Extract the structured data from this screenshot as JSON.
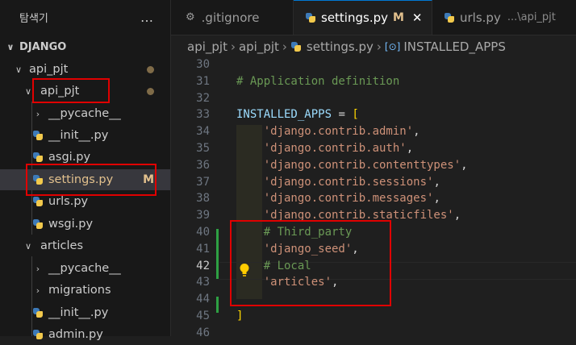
{
  "explorer": {
    "title": "탐색기",
    "more_icon": "…",
    "rows": [
      {
        "label": "DJANGO",
        "chevron": "∨"
      },
      {
        "label": "api_pjt",
        "chevron": "∨"
      },
      {
        "label": "api_pjt",
        "chevron": "∨"
      },
      {
        "label": "__pycache__",
        "chevron": "›"
      },
      {
        "label": "__init__.py"
      },
      {
        "label": "asgi.py"
      },
      {
        "label": "settings.py",
        "badge": "M"
      },
      {
        "label": "urls.py"
      },
      {
        "label": "wsgi.py"
      },
      {
        "label": "articles",
        "chevron": "∨"
      },
      {
        "label": "__pycache__",
        "chevron": "›"
      },
      {
        "label": "migrations",
        "chevron": "›"
      },
      {
        "label": "__init__.py"
      },
      {
        "label": "admin.py"
      }
    ]
  },
  "tabs": [
    {
      "label": ".gitignore",
      "icon": "gear-icon"
    },
    {
      "label": "settings.py",
      "modified": "M",
      "close": "✕",
      "icon": "python-icon"
    },
    {
      "label": "urls.py",
      "desc": "...\\api_pjt",
      "icon": "python-icon"
    }
  ],
  "breadcrumb": {
    "items": [
      "api_pjt",
      "api_pjt",
      "settings.py",
      "INSTALLED_APPS"
    ],
    "symbol": "[⊙]"
  },
  "code": {
    "lines": [
      {
        "n": "30",
        "tokens": []
      },
      {
        "n": "31",
        "tokens": [
          {
            "t": "cmt",
            "v": "# Application definition"
          }
        ]
      },
      {
        "n": "32",
        "tokens": []
      },
      {
        "n": "33",
        "tokens": [
          {
            "t": "id",
            "v": "INSTALLED_APPS"
          },
          {
            "t": "op",
            "v": " = "
          },
          {
            "t": "br",
            "v": "["
          }
        ]
      },
      {
        "n": "34",
        "tokens": [
          {
            "t": "op",
            "v": "    "
          },
          {
            "t": "str",
            "v": "'django.contrib.admin'"
          },
          {
            "t": "op",
            "v": ","
          }
        ]
      },
      {
        "n": "35",
        "tokens": [
          {
            "t": "op",
            "v": "    "
          },
          {
            "t": "str",
            "v": "'django.contrib.auth'"
          },
          {
            "t": "op",
            "v": ","
          }
        ]
      },
      {
        "n": "36",
        "tokens": [
          {
            "t": "op",
            "v": "    "
          },
          {
            "t": "str",
            "v": "'django.contrib.contenttypes'"
          },
          {
            "t": "op",
            "v": ","
          }
        ]
      },
      {
        "n": "37",
        "tokens": [
          {
            "t": "op",
            "v": "    "
          },
          {
            "t": "str",
            "v": "'django.contrib.sessions'"
          },
          {
            "t": "op",
            "v": ","
          }
        ]
      },
      {
        "n": "38",
        "tokens": [
          {
            "t": "op",
            "v": "    "
          },
          {
            "t": "str",
            "v": "'django.contrib.messages'"
          },
          {
            "t": "op",
            "v": ","
          }
        ]
      },
      {
        "n": "39",
        "tokens": [
          {
            "t": "op",
            "v": "    "
          },
          {
            "t": "str",
            "v": "'django.contrib.staticfiles'"
          },
          {
            "t": "op",
            "v": ","
          }
        ]
      },
      {
        "n": "40",
        "tokens": [
          {
            "t": "op",
            "v": "    "
          },
          {
            "t": "cmt",
            "v": "# Third_party"
          }
        ]
      },
      {
        "n": "41",
        "tokens": [
          {
            "t": "op",
            "v": "    "
          },
          {
            "t": "str",
            "v": "'django_seed'"
          },
          {
            "t": "op",
            "v": ","
          }
        ]
      },
      {
        "n": "42",
        "tokens": [
          {
            "t": "op",
            "v": "    "
          },
          {
            "t": "cmt",
            "v": "# Local"
          }
        ]
      },
      {
        "n": "43",
        "tokens": [
          {
            "t": "op",
            "v": "    "
          },
          {
            "t": "str",
            "v": "'articles'"
          },
          {
            "t": "op",
            "v": ","
          }
        ]
      },
      {
        "n": "44",
        "tokens": []
      },
      {
        "n": "45",
        "tokens": [
          {
            "t": "br",
            "v": "]"
          }
        ]
      },
      {
        "n": "46",
        "tokens": []
      }
    ]
  }
}
